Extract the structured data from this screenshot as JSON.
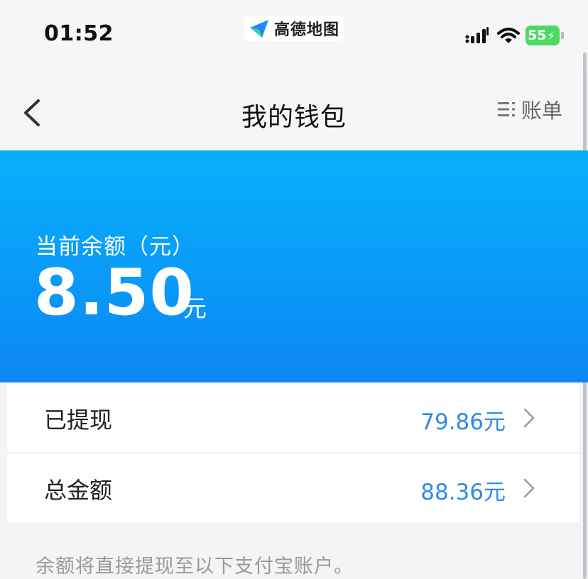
{
  "status_bar": {
    "time": "01:52",
    "app_name": "高德地图",
    "battery_level": "55",
    "battery_charging": true
  },
  "nav": {
    "title": "我的钱包",
    "bills_label": "账单"
  },
  "balance": {
    "label": "当前余额（元）",
    "amount": "8.50",
    "unit": "元"
  },
  "rows": [
    {
      "label": "已提现",
      "value": "79.86元"
    },
    {
      "label": "总金额",
      "value": "88.36元"
    }
  ],
  "footnote": "余额将直接提现至以下支付宝账户。",
  "colors": {
    "accent_blue": "#2f8be6",
    "banner_blue": "#0a9af8",
    "battery_green": "#4cd964"
  },
  "icons": {
    "back": "chevron-left-icon",
    "bills": "list-icon",
    "row_arrow": "chevron-right-icon",
    "app_logo": "amap-logo-icon"
  }
}
